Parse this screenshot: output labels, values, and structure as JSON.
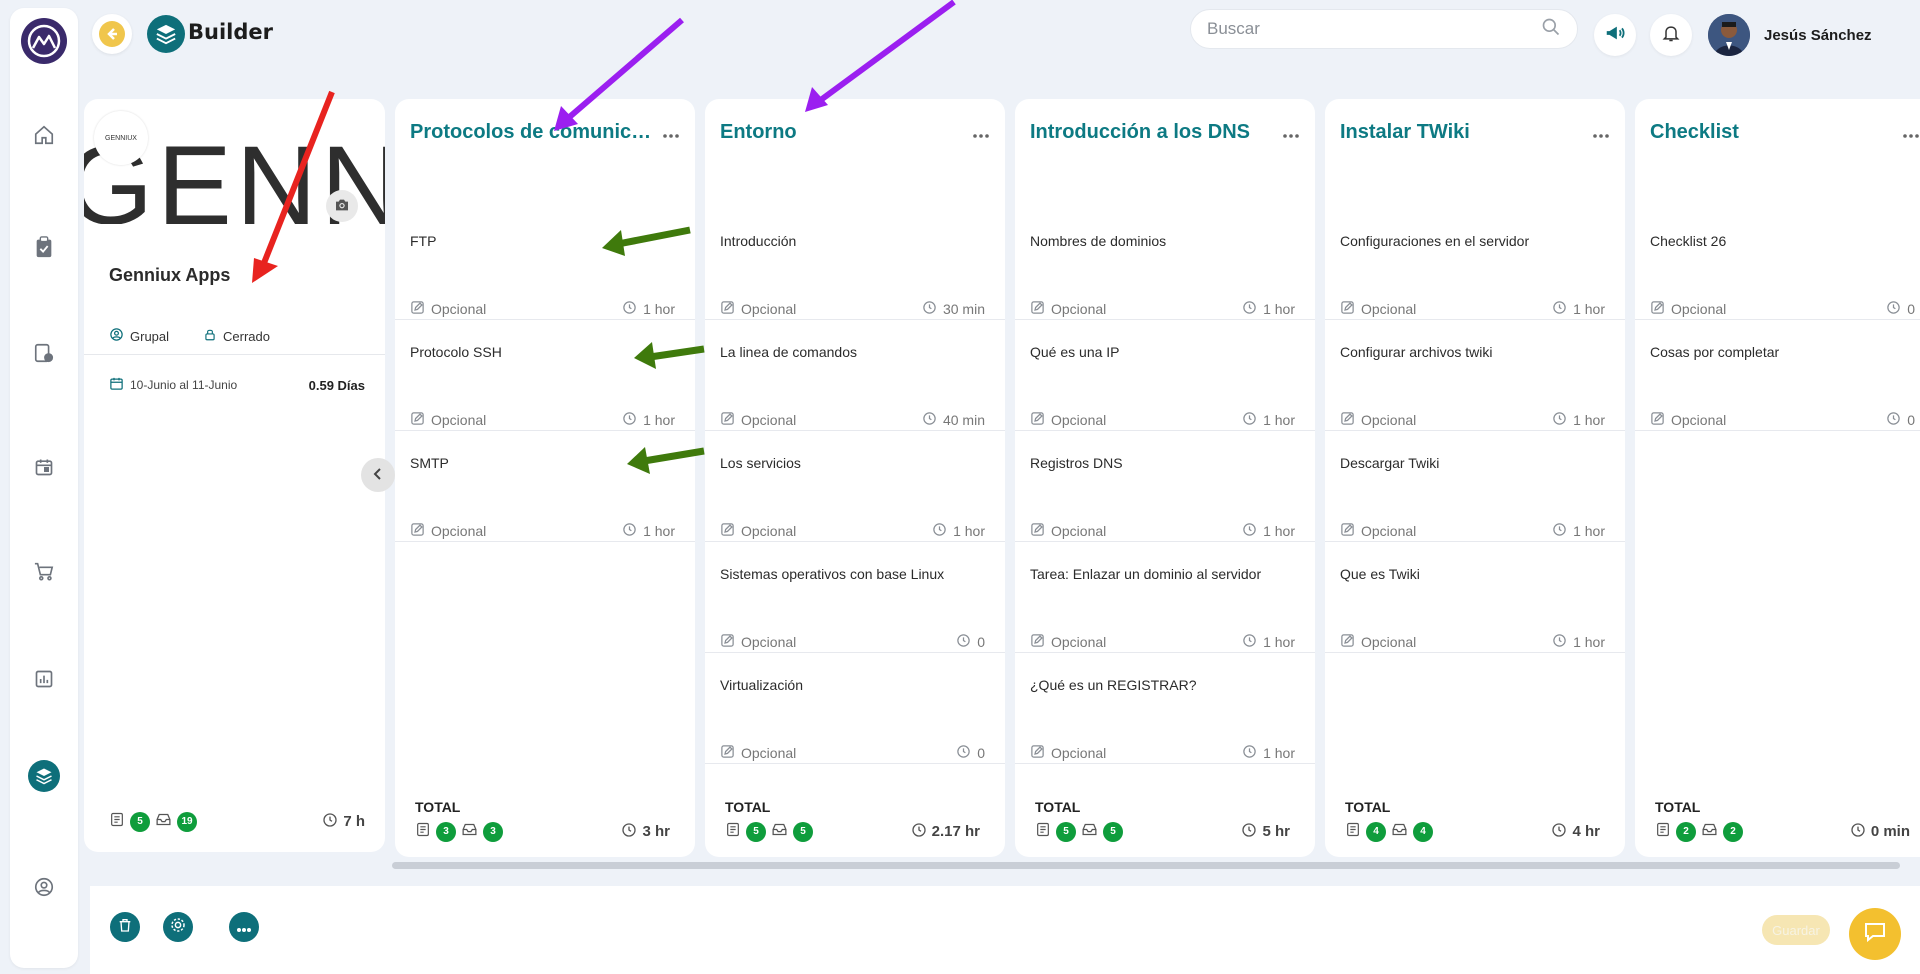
{
  "app": {
    "title": "Builder",
    "back_label": "back"
  },
  "search": {
    "placeholder": "Buscar"
  },
  "user": {
    "name": "Jesús Sánchez"
  },
  "rail": {
    "items": [
      "home-icon",
      "clipboard-check-icon",
      "document-user-icon",
      "calendar-icon",
      "cart-icon",
      "chart-icon",
      "layers-icon",
      "user-circle-icon"
    ],
    "active": "layers-icon"
  },
  "project": {
    "banner_text": "GENNIUX",
    "logo_text": "GENNIUX",
    "name": "Genniux Apps",
    "mode": "Grupal",
    "access": "Cerrado",
    "dates": "10-Junio al 11-Junio",
    "days": "0.59 Días",
    "counts": {
      "docs": "5",
      "inbox": "19"
    },
    "total_time": "7 h"
  },
  "columns": [
    {
      "title": "Protocolos de comunicación",
      "tasks": [
        {
          "title": "FTP",
          "tag": "Opcional",
          "time": "1 hor"
        },
        {
          "title": "Protocolo SSH",
          "tag": "Opcional",
          "time": "1 hor"
        },
        {
          "title": "SMTP",
          "tag": "Opcional",
          "time": "1 hor"
        }
      ],
      "total_label": "TOTAL",
      "docs": "3",
      "inbox": "3",
      "total_time": "3 hr"
    },
    {
      "title": "Entorno",
      "tasks": [
        {
          "title": "Introducción",
          "tag": "Opcional",
          "time": "30 min"
        },
        {
          "title": "La linea de comandos",
          "tag": "Opcional",
          "time": "40 min"
        },
        {
          "title": "Los servicios",
          "tag": "Opcional",
          "time": "1 hor"
        },
        {
          "title": "Sistemas operativos con base Linux",
          "tag": "Opcional",
          "time": "0"
        },
        {
          "title": "Virtualización",
          "tag": "Opcional",
          "time": "0"
        }
      ],
      "total_label": "TOTAL",
      "docs": "5",
      "inbox": "5",
      "total_time": "2.17 hr"
    },
    {
      "title": "Introducción a los DNS",
      "tasks": [
        {
          "title": "Nombres de dominios",
          "tag": "Opcional",
          "time": "1 hor"
        },
        {
          "title": "Qué es una IP",
          "tag": "Opcional",
          "time": "1 hor"
        },
        {
          "title": "Registros DNS",
          "tag": "Opcional",
          "time": "1 hor"
        },
        {
          "title": "Tarea: Enlazar un dominio al servidor",
          "tag": "Opcional",
          "time": "1 hor"
        },
        {
          "title": "¿Qué es un REGISTRAR?",
          "tag": "Opcional",
          "time": "1 hor"
        }
      ],
      "total_label": "TOTAL",
      "docs": "5",
      "inbox": "5",
      "total_time": "5 hr"
    },
    {
      "title": "Instalar TWiki",
      "tasks": [
        {
          "title": "Configuraciones en el servidor",
          "tag": "Opcional",
          "time": "1 hor"
        },
        {
          "title": "Configurar archivos twiki",
          "tag": "Opcional",
          "time": "1 hor"
        },
        {
          "title": "Descargar Twiki",
          "tag": "Opcional",
          "time": "1 hor"
        },
        {
          "title": "Que es Twiki",
          "tag": "Opcional",
          "time": "1 hor"
        }
      ],
      "total_label": "TOTAL",
      "docs": "4",
      "inbox": "4",
      "total_time": "4 hr"
    },
    {
      "title": "Checklist",
      "tasks": [
        {
          "title": "Checklist 26",
          "tag": "Opcional",
          "time": "0"
        },
        {
          "title": "Cosas por completar",
          "tag": "Opcional",
          "time": "0"
        }
      ],
      "total_label": "TOTAL",
      "docs": "2",
      "inbox": "2",
      "total_time": "0 min"
    }
  ],
  "bottom": {
    "save_label": "Guardar"
  },
  "colors": {
    "accent": "#0e6f7a",
    "title": "#0d7a83",
    "badge": "#0f9d3c",
    "back": "#f0c64c",
    "chat": "#f3c02f",
    "arrow_red": "#e8231f",
    "arrow_purple": "#9b1ff0",
    "arrow_green": "#3f7a0c"
  }
}
